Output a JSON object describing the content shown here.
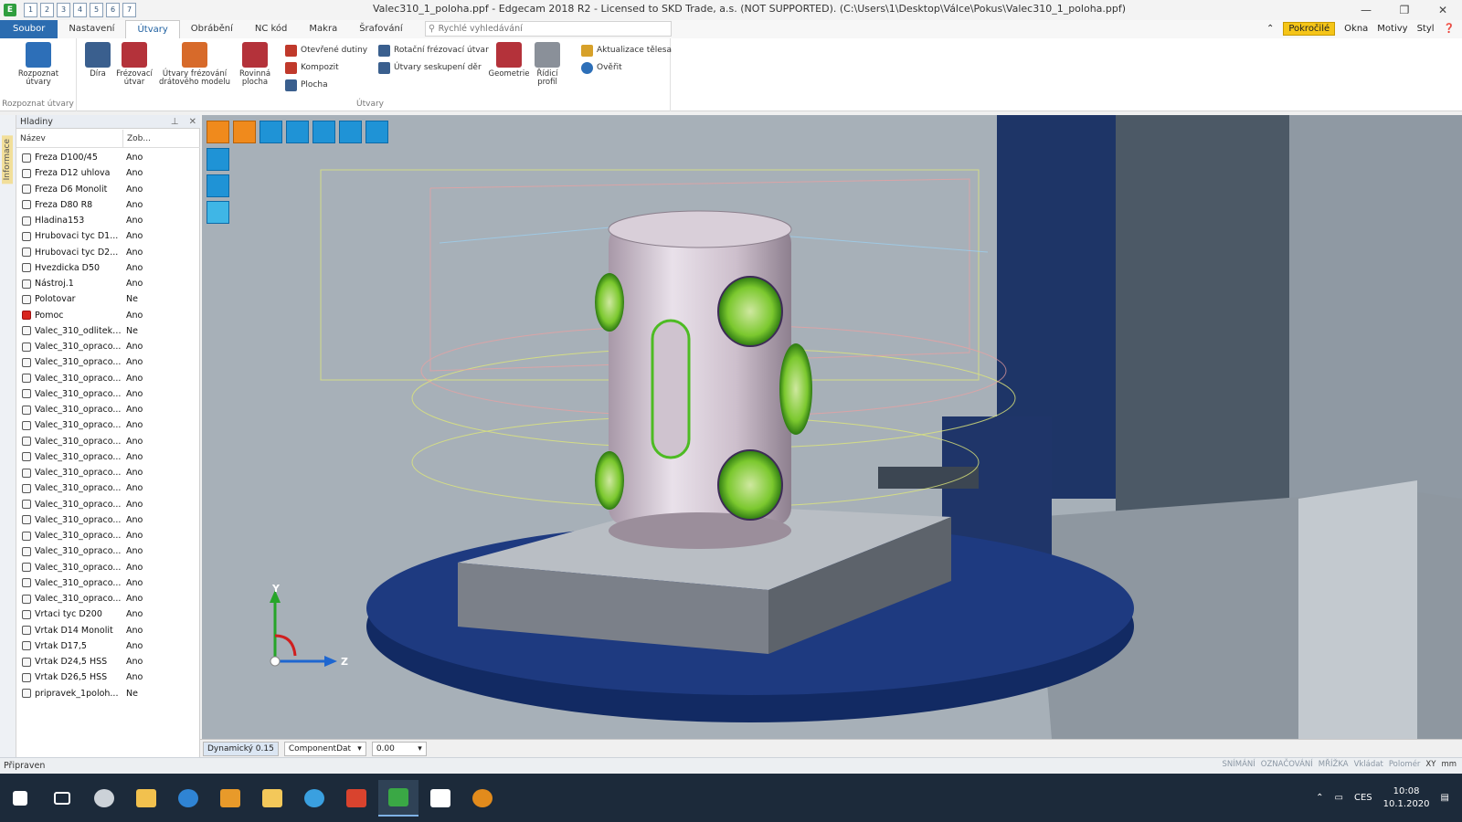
{
  "window": {
    "title": "Valec310_1_poloha.ppf - Edgecam 2018 R2  - Licensed to SKD Trade, a.s. (NOT SUPPORTED). (C:\\Users\\1\\Desktop\\Válce\\Pokus\\Valec310_1_poloha.ppf)",
    "app_icon": "edgecam-icon",
    "qat_labels": [
      "1",
      "2",
      "3",
      "4",
      "5",
      "6",
      "7"
    ],
    "minimize": "—",
    "restore": "❐",
    "close": "✕"
  },
  "menu": {
    "file_tab": "Soubor",
    "tabs": [
      "Nastavení",
      "Útvary",
      "Obrábění",
      "NC kód",
      "Makra",
      "Šrafování"
    ],
    "active_tab": "Útvary",
    "search_placeholder": "Rychlé vyhledávání",
    "right": {
      "advanced": "Pokročilé",
      "windows": "Okna",
      "themes": "Motivy",
      "style": "Styl"
    }
  },
  "ribbon": {
    "groups": [
      {
        "label": "Rozpoznat útvary",
        "buttons": [
          {
            "label": "Rozpoznat útvary",
            "icon": "feature-recognize-icon",
            "color": "#2d6fb8"
          }
        ]
      },
      {
        "label": "Útvary",
        "big_buttons": [
          {
            "label": "Díra",
            "icon": "hole-icon",
            "color": "#3a5f8e"
          },
          {
            "label": "Frézovací útvar",
            "icon": "mill-feature-icon",
            "color": "#b4323a"
          },
          {
            "label": "Útvary frézování drátového modelu",
            "icon": "wireframe-mill-icon",
            "color": "#d76a2a"
          },
          {
            "label": "Rovinná plocha",
            "icon": "planar-face-icon",
            "color": "#b4323a"
          }
        ],
        "small_col1": [
          {
            "label": "Otevřené dutiny",
            "icon": "open-pocket-icon",
            "color": "#c0392b"
          },
          {
            "label": "Kompozit",
            "icon": "composite-icon",
            "color": "#c0392b"
          },
          {
            "label": "Plocha",
            "icon": "surface-icon",
            "color": "#3a5f8e"
          }
        ],
        "small_col2": [
          {
            "label": "Rotační frézovací útvar",
            "icon": "rotary-mill-icon",
            "color": "#3a5f8e"
          },
          {
            "label": "Útvary seskupení děr",
            "icon": "hole-group-icon",
            "color": "#3a5f8e"
          }
        ],
        "big_buttons2": [
          {
            "label": "Geometrie",
            "icon": "geometry-icon",
            "color": "#b4323a"
          },
          {
            "label": "Řídicí profil",
            "icon": "control-profile-icon",
            "color": "#8a9099"
          }
        ],
        "small_col3": [
          {
            "label": "Aktualizace tělesa",
            "icon": "update-body-icon",
            "color": "#d7a12a"
          },
          {
            "label": "Ověřit",
            "icon": "verify-icon",
            "color": "#2d6fb8"
          }
        ]
      }
    ]
  },
  "panel": {
    "side_tab": "Informace",
    "title": "Hladiny",
    "pin": "⊥",
    "close": "✕",
    "columns": [
      "Název",
      "Zob..."
    ],
    "layers": [
      {
        "name": "Freza D100/45",
        "visible": "Ano"
      },
      {
        "name": "Freza D12 uhlova",
        "visible": "Ano"
      },
      {
        "name": "Freza D6 Monolit",
        "visible": "Ano"
      },
      {
        "name": "Freza D80 R8",
        "visible": "Ano"
      },
      {
        "name": "Hladina153",
        "visible": "Ano"
      },
      {
        "name": "Hrubovaci tyc D1...",
        "visible": "Ano"
      },
      {
        "name": "Hrubovaci tyc D2...",
        "visible": "Ano"
      },
      {
        "name": "Hvezdicka D50",
        "visible": "Ano"
      },
      {
        "name": "Nástroj.1",
        "visible": "Ano"
      },
      {
        "name": "Polotovar",
        "visible": "Ne"
      },
      {
        "name": "Pomoc",
        "visible": "Ano"
      },
      {
        "name": "Valec_310_odlitek ...",
        "visible": "Ne"
      },
      {
        "name": "Valec_310_opraco...",
        "visible": "Ano"
      },
      {
        "name": "Valec_310_opraco...",
        "visible": "Ano"
      },
      {
        "name": "Valec_310_opraco...",
        "visible": "Ano"
      },
      {
        "name": "Valec_310_opraco...",
        "visible": "Ano"
      },
      {
        "name": "Valec_310_opraco...",
        "visible": "Ano"
      },
      {
        "name": "Valec_310_opraco...",
        "visible": "Ano"
      },
      {
        "name": "Valec_310_opraco...",
        "visible": "Ano"
      },
      {
        "name": "Valec_310_opraco...",
        "visible": "Ano"
      },
      {
        "name": "Valec_310_opraco...",
        "visible": "Ano"
      },
      {
        "name": "Valec_310_opraco...",
        "visible": "Ano"
      },
      {
        "name": "Valec_310_opraco...",
        "visible": "Ano"
      },
      {
        "name": "Valec_310_opraco...",
        "visible": "Ano"
      },
      {
        "name": "Valec_310_opraco...",
        "visible": "Ano"
      },
      {
        "name": "Valec_310_opraco...",
        "visible": "Ano"
      },
      {
        "name": "Valec_310_opraco...",
        "visible": "Ano"
      },
      {
        "name": "Valec_310_opraco...",
        "visible": "Ano"
      },
      {
        "name": "Valec_310_opraco...",
        "visible": "Ano"
      },
      {
        "name": "Vrtaci tyc D200",
        "visible": "Ano"
      },
      {
        "name": "Vrtak D14 Monolit",
        "visible": "Ano"
      },
      {
        "name": "Vrtak D17,5",
        "visible": "Ano"
      },
      {
        "name": "Vrtak D24,5 HSS",
        "visible": "Ano"
      },
      {
        "name": "Vrtak D26,5 HSS",
        "visible": "Ano"
      },
      {
        "name": "pripravek_1poloh...",
        "visible": "Ne"
      }
    ]
  },
  "viewport": {
    "axis_y": "Y",
    "axis_z": "Z",
    "toolbar_icons": [
      "solid-view-icon",
      "section-view-icon",
      "layout-view-icon",
      "pan-icon",
      "zoom-icon",
      "list-view-icon",
      "grid-view-icon"
    ],
    "side_icons": [
      "iso-view-icon",
      "top-view-icon",
      "front-view-icon"
    ]
  },
  "viewbar": {
    "dynamic": "Dynamický 0.15",
    "component": "ComponentDat",
    "value": "0.00"
  },
  "status": {
    "ready": "Připraven",
    "right_items": [
      "SNÍMÁNÍ",
      "OZNAČOVÁNÍ",
      "MŘÍŽKA",
      "Vkládat",
      "Polomér"
    ],
    "plane": "XY",
    "units": "mm"
  },
  "taskbar": {
    "apps": [
      "start-icon",
      "task-view-icon",
      "security-icon",
      "file-explorer-icon",
      "edge-icon",
      "media-icon",
      "mail-icon",
      "ie-icon",
      "pdf-icon",
      "edgecam-taskbar-icon",
      "video-icon",
      "cat-icon"
    ],
    "active_app": "edgecam-taskbar-icon",
    "language": "CES",
    "time": "10:08",
    "date": "10.1.2020"
  }
}
